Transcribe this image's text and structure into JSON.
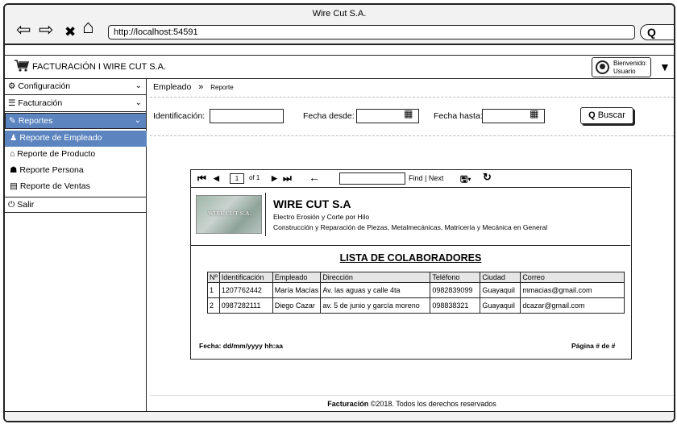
{
  "window": {
    "title": "Wire Cut S.A.",
    "url": "http://localhost:54591"
  },
  "browser": {
    "back_glyph": "⇦",
    "forward_glyph": "⇨",
    "close_glyph": "✖",
    "home_glyph": "⌂",
    "search_glyph": "Q"
  },
  "header": {
    "brand": "FACTURACIÓN  I  WIRE CUT S.A.",
    "welcome_line1": "Bienvenido:",
    "welcome_line2": "Usuario"
  },
  "sidebar": {
    "items": [
      {
        "label": "Configuración",
        "icon": "gears-icon"
      },
      {
        "label": "Facturación",
        "icon": "list-icon"
      },
      {
        "label": "Reportes",
        "icon": "edit-icon",
        "active": true
      },
      {
        "label": "Salir",
        "icon": "power-icon"
      }
    ],
    "submenu": [
      {
        "label": "Reporte de Empleado",
        "icon": "person-icon",
        "selected": true
      },
      {
        "label": "Reporte de Producto",
        "icon": "store-icon"
      },
      {
        "label": "Reporte Persona",
        "icon": "users-icon"
      },
      {
        "label": "Reporte de Ventas",
        "icon": "chart-icon"
      }
    ]
  },
  "breadcrumb": {
    "root": "Empleado",
    "sep": "»",
    "leaf": "Reporte"
  },
  "filters": {
    "id_label": "Identificación:",
    "from_label": "Fecha desde:",
    "to_label": "Fecha hasta:",
    "search_button": "Buscar"
  },
  "report_toolbar": {
    "page_value": "1",
    "of_text": "of 1",
    "find_text": "Find | Next"
  },
  "report": {
    "company": "WIRE CUT S.A",
    "logo_text": "WIRE CUT S.A.",
    "line1": "Electro Erosión y Corte por Hilo",
    "line2": "Construcción y Reparación de Piezas, Metalmecánicas, Matricería y Mecánica en General",
    "title": "LISTA DE COLABORADORES",
    "columns": [
      "Nº",
      "Identificación",
      "Empleado",
      "Dirección",
      "Teléfono",
      "Ciudad",
      "Correo"
    ],
    "rows": [
      [
        "1",
        "1207762442",
        "María Macías",
        "Av. las aguas y calle 4ta",
        "0982839099",
        "Guayaquil",
        "mmacias@gmail.com"
      ],
      [
        "2",
        "0987282111",
        "Diego Cazar",
        "av. 5 de junio y garcía moreno",
        "098838321",
        "Guayaquil",
        "dcazar@gmail.com"
      ]
    ],
    "date_footer": "Fecha: dd/mm/yyyy hh:aa",
    "page_footer": "Página # de #"
  },
  "footer": {
    "bold": "Facturación",
    "rest": " ©2018. Todos los derechos reservados"
  }
}
